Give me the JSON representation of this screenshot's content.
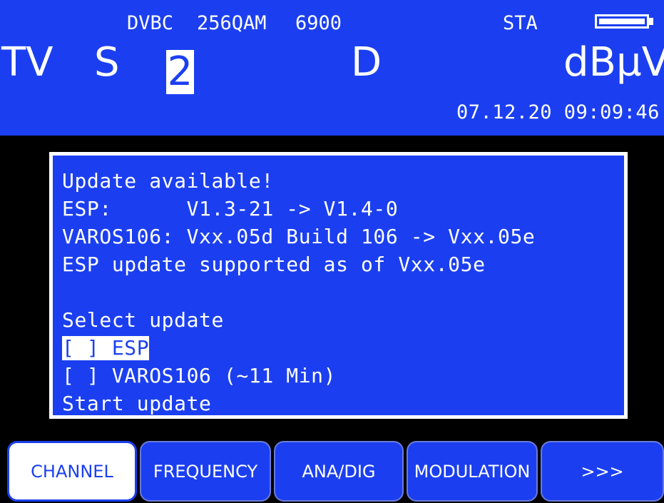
{
  "header": {
    "mode": "DVBC",
    "modulation": "256QAM",
    "symbol_rate": "6900",
    "status": "STA",
    "band": "TV",
    "sub_band": "S",
    "channel": "2",
    "type": "D",
    "unit": "dBµV",
    "datetime": "07.12.20 09:09:46"
  },
  "dialog": {
    "lines": [
      "Update available!",
      "ESP:      V1.3-21 -> V1.4-0",
      "VAROS106: Vxx.05d Build 106 -> Vxx.05e",
      "ESP update supported as of Vxx.05e",
      "",
      "Select update",
      "[ ] ESP",
      "[ ] VAROS106 (~11 Min)",
      "Start update"
    ],
    "selected_index": 6
  },
  "softkeys": [
    {
      "label": "CHANNEL",
      "active": true
    },
    {
      "label": "FREQUENCY",
      "active": false
    },
    {
      "label": "ANA/DIG",
      "active": false
    },
    {
      "label": "MODULATION",
      "active": false
    },
    {
      "label": ">>>",
      "active": false
    }
  ],
  "colors": {
    "screen_blue": "#1b3ff0",
    "background": "#000000",
    "text": "#ffffff"
  }
}
